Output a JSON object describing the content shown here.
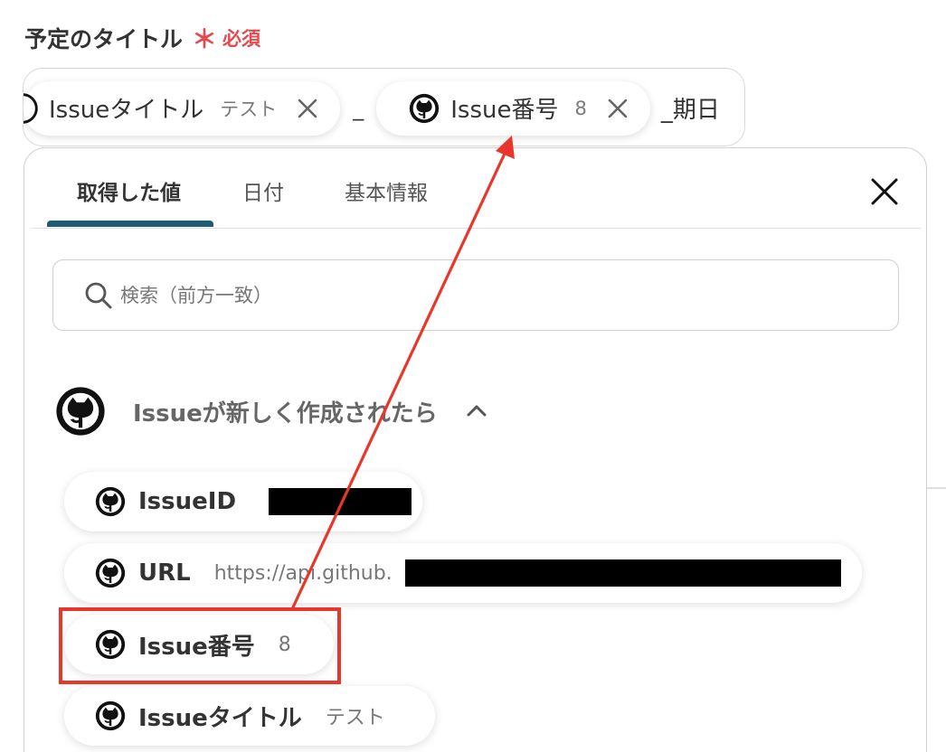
{
  "field": {
    "label": "予定のタイトル",
    "required_star": "＊",
    "required_text": "必須"
  },
  "title_row": {
    "chip1_label": "Issueタイトル",
    "chip1_value": "テスト",
    "sep1": "_",
    "chip2_label": "Issue番号",
    "chip2_value": "8",
    "suffix": "_期日"
  },
  "tabs": [
    "取得した値",
    "日付",
    "基本情報"
  ],
  "search": {
    "placeholder": "検索（前方一致）"
  },
  "group": {
    "title": "Issueが新しく作成されたら"
  },
  "items": [
    {
      "label": "IssueID",
      "value": ""
    },
    {
      "label": "URL",
      "value": "https://api.github."
    },
    {
      "label": "Issue番号",
      "value": "8"
    },
    {
      "label": "Issueタイトル",
      "value": "テスト"
    }
  ],
  "colors": {
    "accent": "#1e5c75",
    "required": "#e5484d",
    "highlight": "#e8372a"
  }
}
